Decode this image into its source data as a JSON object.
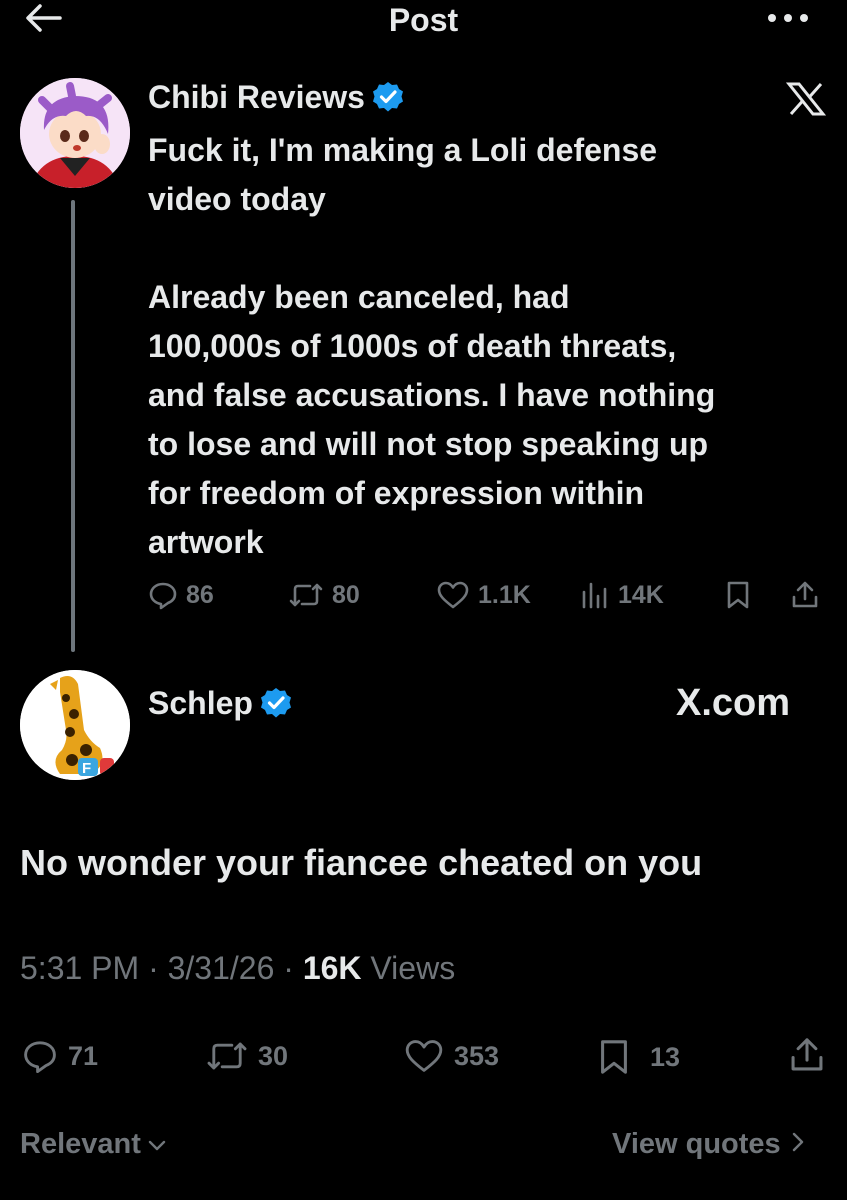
{
  "header": {
    "title": "Post",
    "back_icon": "back-arrow-icon",
    "more_icon": "more-dots-icon"
  },
  "quoted_post": {
    "author": "Chibi Reviews",
    "verified": true,
    "text_paragraphs": [
      [
        "Fuck it, I'm making a Loli defense",
        "video today"
      ],
      [
        "Already been canceled, had",
        "100,000s of 1000s of death threats,",
        "and false accusations. I have nothing",
        "to lose and will not stop speaking up",
        "for freedom of expression within",
        "artwork"
      ]
    ],
    "stats": {
      "replies": "86",
      "reposts": "80",
      "likes": "1.1K",
      "views": "14K"
    }
  },
  "reply_post": {
    "author": "Schlep",
    "verified": true,
    "source_label": "X.com",
    "text": "No wonder your fiancee cheated on you",
    "time": "5:31 PM",
    "date": "3/31/26",
    "views_count": "16K",
    "views_label": "Views",
    "separator": "·",
    "stats": {
      "replies": "71",
      "reposts": "30",
      "likes": "353",
      "bookmarks": "13"
    }
  },
  "footer": {
    "sort_label": "Relevant",
    "quotes_link": "View quotes"
  },
  "colors": {
    "background": "#000000",
    "text": "#e7e9ea",
    "muted": "#71767b",
    "verified": "#1d9bf0"
  }
}
